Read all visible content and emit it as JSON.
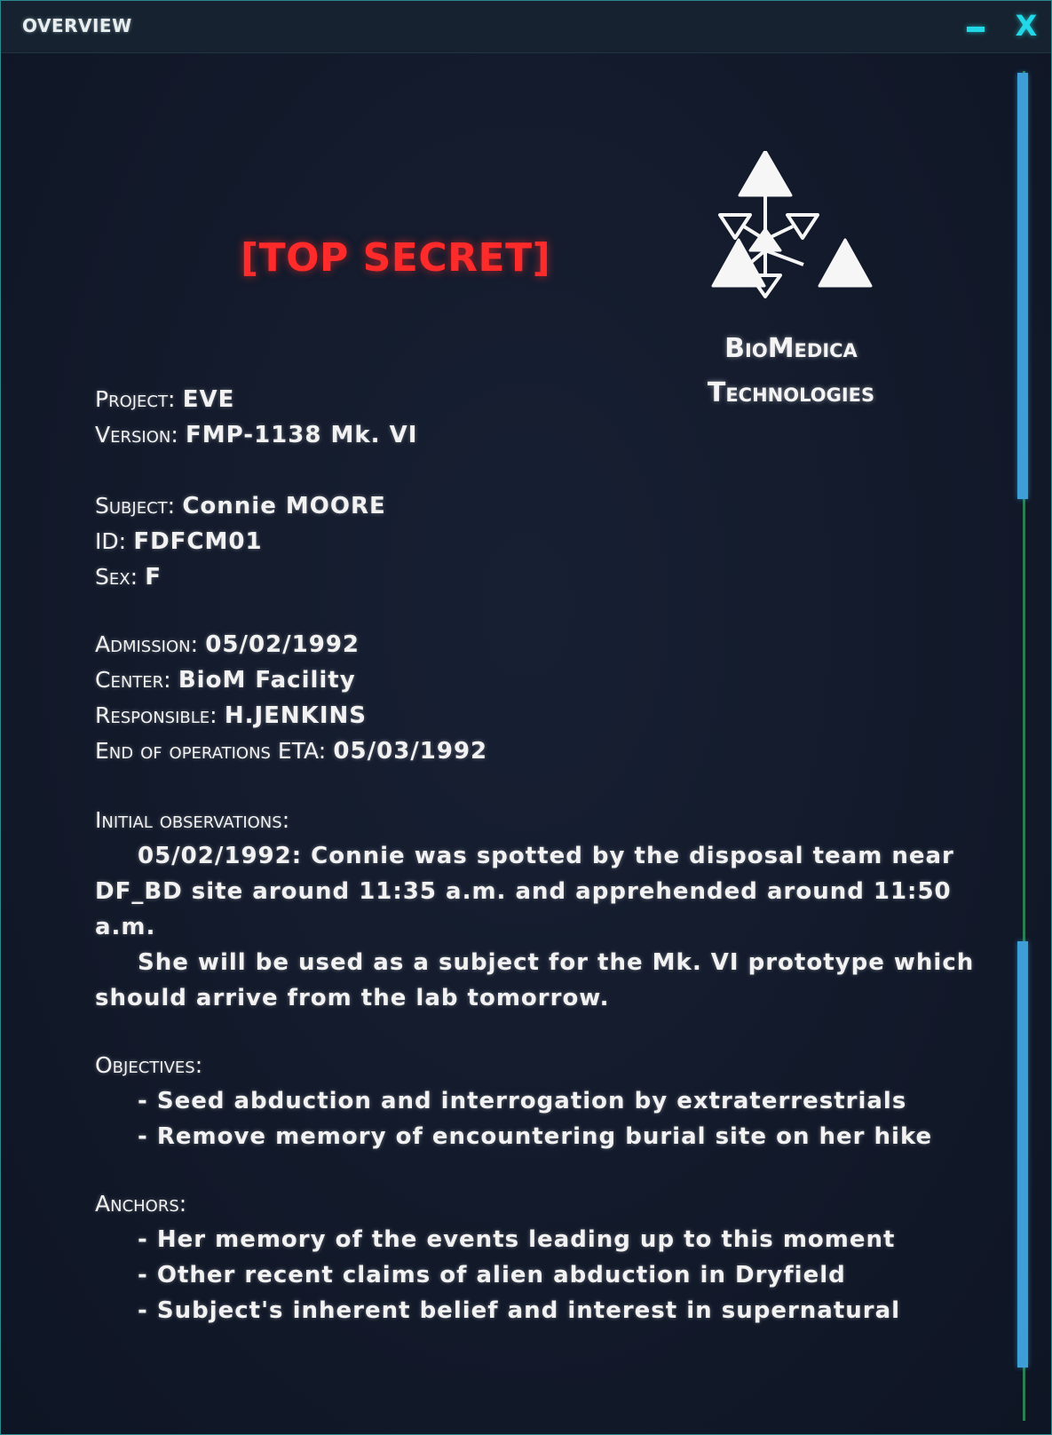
{
  "window": {
    "title": "OVERVIEW",
    "minimize_label": "–",
    "close_label": "X"
  },
  "document": {
    "classification": "[TOP SECRET]",
    "company": {
      "line1": "BioMedica",
      "line2": "Technologies",
      "logo_icon": "triangle-network-icon"
    },
    "fields": {
      "project": {
        "label": "Project:",
        "value": "EVE"
      },
      "version": {
        "label": "Version:",
        "value": "FMP-1138 Mk. VI"
      },
      "subject": {
        "label": "Subject:",
        "value": "Connie MOORE"
      },
      "id": {
        "label": "ID:",
        "value": "FDFCM01"
      },
      "sex": {
        "label": "Sex:",
        "value": "F"
      },
      "admission": {
        "label": "Admission:",
        "value": "05/02/1992"
      },
      "center": {
        "label": "Center:",
        "value": "BioM Facility"
      },
      "responsible": {
        "label": "Responsible:",
        "value": "H.JENKINS"
      },
      "end_eta": {
        "label": "End of operations ETA:",
        "value": "05/03/1992"
      }
    },
    "initial_observations": {
      "heading": "Initial observations:",
      "para1_line1": "05/02/1992: Connie was spotted by the disposal team near",
      "para1_line2": "DF_BD site around 11:35 a.m. and apprehended around 11:50",
      "para1_line3": "a.m.",
      "para2_line1": "She will be used as a subject for the Mk. VI prototype which",
      "para2_line2": "should arrive from the lab tomorrow."
    },
    "objectives": {
      "heading": "Objectives:",
      "items": [
        "- Seed abduction and interrogation by extraterrestrials",
        "- Remove memory of encountering burial site on her hike"
      ]
    },
    "anchors": {
      "heading": "Anchors:",
      "items": [
        "- Her memory of the events leading up to this moment",
        "- Other recent claims of alien abduction in Dryfield",
        "- Subject's inherent belief and interest in supernatural"
      ]
    }
  },
  "colors": {
    "accent": "#22d8e6",
    "secret_red": "#ff2a2a",
    "scroll_thumb": "#3e9ed8",
    "background": "#121a2b"
  }
}
